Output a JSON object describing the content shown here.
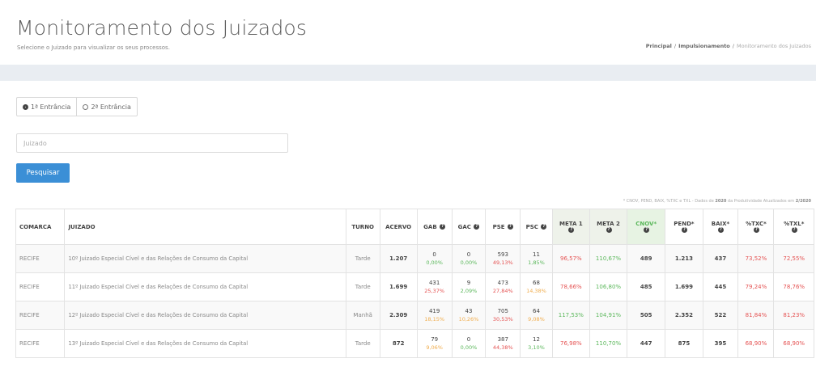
{
  "header": {
    "title": "Monitoramento dos Juizados",
    "subtitle": "Selecione o Juizado para visualizar os seus processos.",
    "breadcrumb": [
      {
        "label": "Principal",
        "current": false
      },
      {
        "label": "Impulsionamento",
        "current": false
      },
      {
        "label": "Monitoramento dos Juizados",
        "current": true
      }
    ]
  },
  "filters": {
    "radios": [
      {
        "label": "1ª Entrância",
        "selected": true
      },
      {
        "label": "2ª Entrância",
        "selected": false
      }
    ],
    "search_placeholder": "Juizado",
    "search_button": "Pesquisar"
  },
  "note": {
    "prefix": "* CNOV, PEND, BAIX, %TXC e TXL - Dados de",
    "year": "2020",
    "suffix": "da Produtividade Atualizados em",
    "date": "2/2020"
  },
  "colors": {
    "accent": "#3b8fd6",
    "red": "#e55353",
    "green": "#5cb85c",
    "orange": "#f0ad4e"
  },
  "table": {
    "headers": {
      "comarca": "COMARCA",
      "juizado": "JUIZADO",
      "turno": "TURNO",
      "acervo": "ACERVO",
      "gab": "GAB",
      "gac": "GAC",
      "pse": "PSE",
      "psc": "PSC",
      "meta1": "META 1",
      "meta2": "META 2",
      "cnov": "CNOV*",
      "pend": "PEND*",
      "baix": "BAIX*",
      "txc": "%TXC*",
      "txl": "%TXL*"
    },
    "info_icon": "info-circle-icon",
    "rows": [
      {
        "comarca": "RECIFE",
        "juizado": "10º Juizado Especial Cível e das Relações de Consumo da Capital",
        "turno": "Tarde",
        "acervo": "1.207",
        "gab": {
          "n": "0",
          "p": "0,00%",
          "c": "green"
        },
        "gac": {
          "n": "0",
          "p": "0,00%",
          "c": "green"
        },
        "pse": {
          "n": "593",
          "p": "49,13%",
          "c": "red"
        },
        "psc": {
          "n": "11",
          "p": "1,85%",
          "c": "green"
        },
        "meta1": {
          "v": "96,57%",
          "c": "red"
        },
        "meta2": {
          "v": "110,67%",
          "c": "green"
        },
        "cnov": "489",
        "pend": "1.213",
        "baix": "437",
        "txc": {
          "v": "73,52%",
          "c": "red"
        },
        "txl": {
          "v": "72,55%",
          "c": "red"
        }
      },
      {
        "comarca": "RECIFE",
        "juizado": "11º Juizado Especial Cível e das Relações de Consumo da Capital",
        "turno": "Tarde",
        "acervo": "1.699",
        "gab": {
          "n": "431",
          "p": "25,37%",
          "c": "red"
        },
        "gac": {
          "n": "9",
          "p": "2,09%",
          "c": "green"
        },
        "pse": {
          "n": "473",
          "p": "27,84%",
          "c": "red"
        },
        "psc": {
          "n": "68",
          "p": "14,38%",
          "c": "orange"
        },
        "meta1": {
          "v": "78,66%",
          "c": "red"
        },
        "meta2": {
          "v": "106,80%",
          "c": "green"
        },
        "cnov": "485",
        "pend": "1.699",
        "baix": "445",
        "txc": {
          "v": "79,24%",
          "c": "red"
        },
        "txl": {
          "v": "78,76%",
          "c": "red"
        }
      },
      {
        "comarca": "RECIFE",
        "juizado": "12º Juizado Especial Cível e das Relações de Consumo da Capital",
        "turno": "Manhã",
        "acervo": "2.309",
        "gab": {
          "n": "419",
          "p": "18,15%",
          "c": "orange"
        },
        "gac": {
          "n": "43",
          "p": "10,26%",
          "c": "orange"
        },
        "pse": {
          "n": "705",
          "p": "30,53%",
          "c": "red"
        },
        "psc": {
          "n": "64",
          "p": "9,08%",
          "c": "orange"
        },
        "meta1": {
          "v": "117,53%",
          "c": "green"
        },
        "meta2": {
          "v": "104,91%",
          "c": "green"
        },
        "cnov": "505",
        "pend": "2.352",
        "baix": "522",
        "txc": {
          "v": "81,84%",
          "c": "red"
        },
        "txl": {
          "v": "81,23%",
          "c": "red"
        }
      },
      {
        "comarca": "RECIFE",
        "juizado": "13º Juizado Especial Cível e das Relações de Consumo da Capital",
        "turno": "Tarde",
        "acervo": "872",
        "gab": {
          "n": "79",
          "p": "9,06%",
          "c": "orange"
        },
        "gac": {
          "n": "0",
          "p": "0,00%",
          "c": "green"
        },
        "pse": {
          "n": "387",
          "p": "44,38%",
          "c": "red"
        },
        "psc": {
          "n": "12",
          "p": "3,10%",
          "c": "green"
        },
        "meta1": {
          "v": "76,98%",
          "c": "red"
        },
        "meta2": {
          "v": "110,70%",
          "c": "green"
        },
        "cnov": "447",
        "pend": "875",
        "baix": "395",
        "txc": {
          "v": "68,90%",
          "c": "red"
        },
        "txl": {
          "v": "68,90%",
          "c": "red"
        }
      }
    ]
  }
}
